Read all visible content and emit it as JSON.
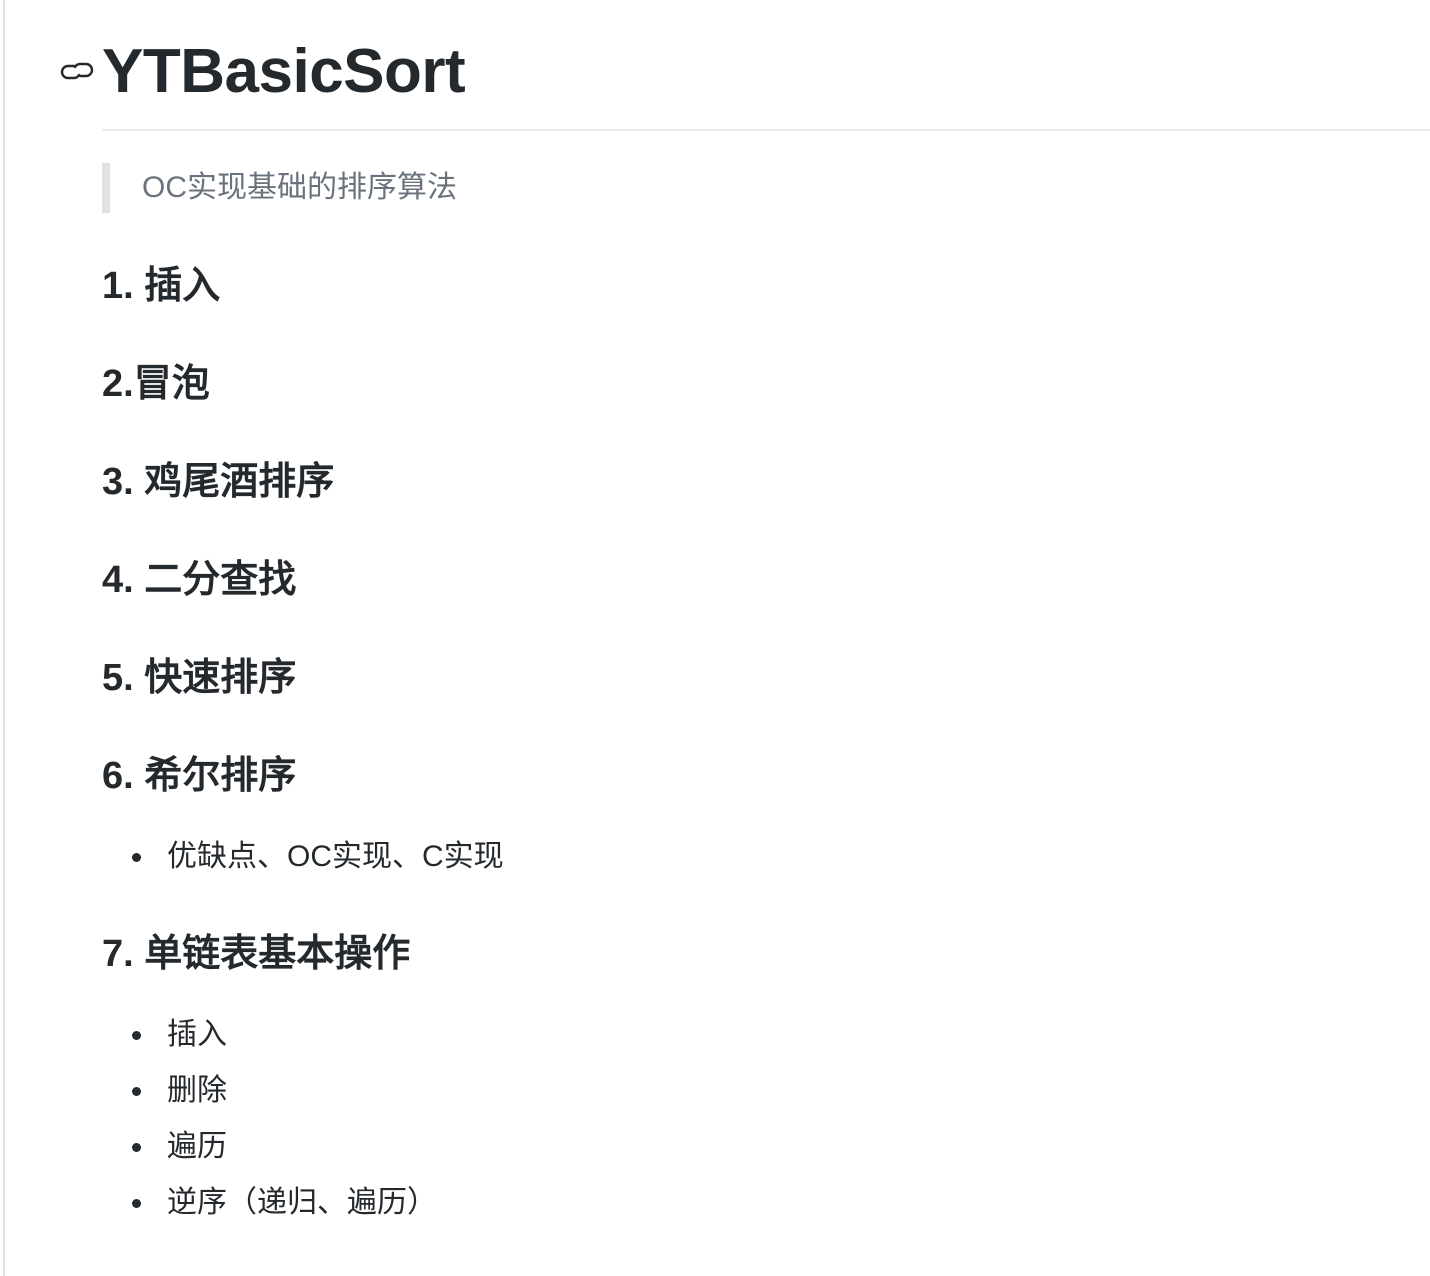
{
  "title": "YTBasicSort",
  "description": "OC实现基础的排序算法",
  "sections": [
    {
      "heading": "1. 插入"
    },
    {
      "heading": "2.冒泡"
    },
    {
      "heading": "3. 鸡尾酒排序"
    },
    {
      "heading": "4. 二分查找"
    },
    {
      "heading": "5. 快速排序"
    },
    {
      "heading": "6. 希尔排序",
      "items": [
        "优缺点、OC实现、C实现"
      ]
    },
    {
      "heading": "7. 单链表基本操作",
      "items": [
        "插入",
        "删除",
        "遍历",
        "逆序（递归、遍历）"
      ]
    }
  ]
}
